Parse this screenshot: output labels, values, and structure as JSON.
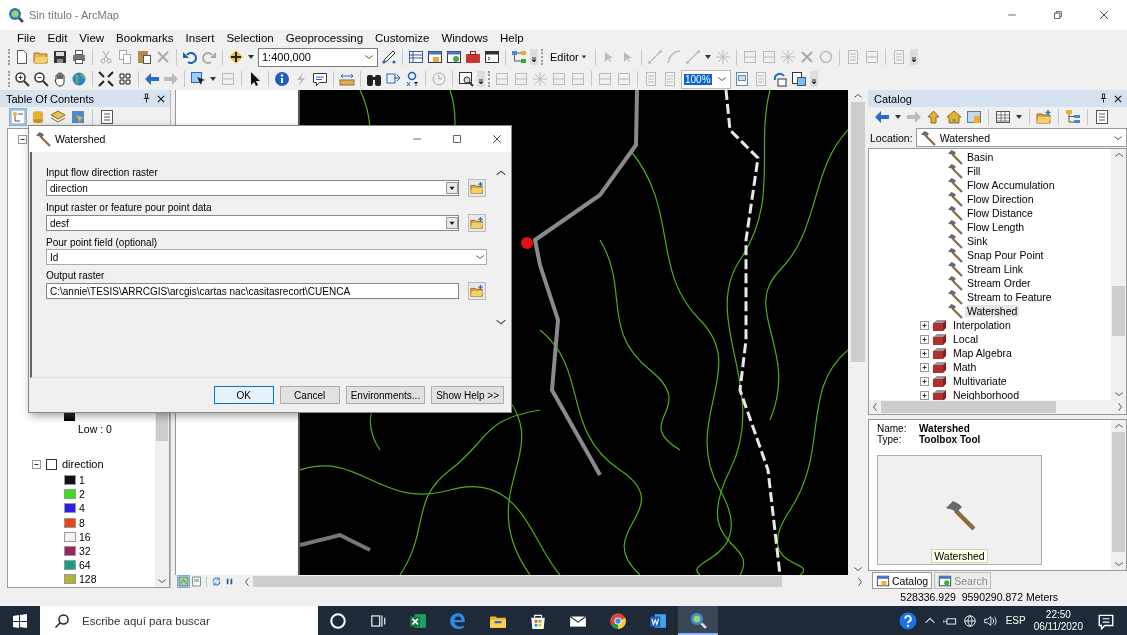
{
  "window": {
    "title": "Sin título - ArcMap"
  },
  "menu": [
    "File",
    "Edit",
    "View",
    "Bookmarks",
    "Insert",
    "Selection",
    "Geoprocessing",
    "Customize",
    "Windows",
    "Help"
  ],
  "toolbar": {
    "scale": "1:400,000",
    "editor": "Editor",
    "zoom": {
      "value": "100%",
      "selected": true
    }
  },
  "toc": {
    "title": "Table Of Contents",
    "top_group": {
      "expanded": true
    },
    "ramp_label": "Low : 0",
    "layers": [
      {
        "name": "direction",
        "checked": false,
        "expanded": true,
        "legend": [
          {
            "label": "1",
            "color": "#0d1512"
          },
          {
            "label": "2",
            "color": "#3ddc1c"
          },
          {
            "label": "4",
            "color": "#2a1de8"
          },
          {
            "label": "8",
            "color": "#e8461a"
          },
          {
            "label": "16",
            "color": "#f8eef5"
          },
          {
            "label": "32",
            "color": "#9a2560"
          },
          {
            "label": "64",
            "color": "#14a07a"
          },
          {
            "label": "128",
            "color": "#b5b135"
          }
        ]
      }
    ]
  },
  "dialog": {
    "title": "Watershed",
    "fields": [
      {
        "label": "Input flow direction raster",
        "value": "direction",
        "kind": "combo_browse"
      },
      {
        "label": "Input raster or feature pour point data",
        "value": "desf",
        "kind": "combo_browse"
      },
      {
        "label": "Pour point field (optional)",
        "value": "Id",
        "kind": "dropdown"
      },
      {
        "label": "Output raster",
        "value": "C:\\annie\\TESIS\\ARRCGIS\\arcgis\\cartas nac\\casitasrecort\\CUENCA",
        "kind": "text_browse"
      }
    ],
    "buttons": [
      {
        "label": "OK",
        "default": true
      },
      {
        "label": "Cancel",
        "default": false
      },
      {
        "label": "Environments...",
        "default": false
      },
      {
        "label": "Show Help >>",
        "default": false
      }
    ]
  },
  "catalog": {
    "title": "Catalog",
    "location_label": "Location:",
    "location": "Watershed",
    "tree": [
      {
        "label": "Basin",
        "kind": "tool",
        "selected": false
      },
      {
        "label": "Fill",
        "kind": "tool",
        "selected": false
      },
      {
        "label": "Flow Accumulation",
        "kind": "tool",
        "selected": false
      },
      {
        "label": "Flow Direction",
        "kind": "tool",
        "selected": false
      },
      {
        "label": "Flow Distance",
        "kind": "tool",
        "selected": false
      },
      {
        "label": "Flow Length",
        "kind": "tool",
        "selected": false
      },
      {
        "label": "Sink",
        "kind": "tool",
        "selected": false
      },
      {
        "label": "Snap Pour Point",
        "kind": "tool",
        "selected": false
      },
      {
        "label": "Stream Link",
        "kind": "tool",
        "selected": false
      },
      {
        "label": "Stream Order",
        "kind": "tool",
        "selected": false
      },
      {
        "label": "Stream to Feature",
        "kind": "tool",
        "selected": false
      },
      {
        "label": "Watershed",
        "kind": "tool",
        "selected": true
      },
      {
        "label": "Interpolation",
        "kind": "toolset",
        "selected": false,
        "expanded": false
      },
      {
        "label": "Local",
        "kind": "toolset",
        "selected": false,
        "expanded": false
      },
      {
        "label": "Map Algebra",
        "kind": "toolset",
        "selected": false,
        "expanded": false
      },
      {
        "label": "Math",
        "kind": "toolset",
        "selected": false,
        "expanded": false
      },
      {
        "label": "Multivariate",
        "kind": "toolset",
        "selected": false,
        "expanded": false
      },
      {
        "label": "Neighborhood",
        "kind": "toolset",
        "selected": false,
        "expanded": false
      }
    ],
    "details": {
      "name_label": "Name:",
      "name": "Watershed",
      "type_label": "Type:",
      "type": "Toolbox Tool",
      "thumbnail_caption": "Watershed"
    },
    "tabs": [
      {
        "label": "Catalog",
        "selected": true
      },
      {
        "label": "Search",
        "selected": false
      }
    ]
  },
  "status_bar": {
    "coordinates": "528336.929  9590290.872 Meters"
  },
  "taskbar": {
    "search_placeholder": "Escribe aquí para buscar",
    "language": "ESP",
    "time": "22:50",
    "date": "06/11/2020"
  }
}
